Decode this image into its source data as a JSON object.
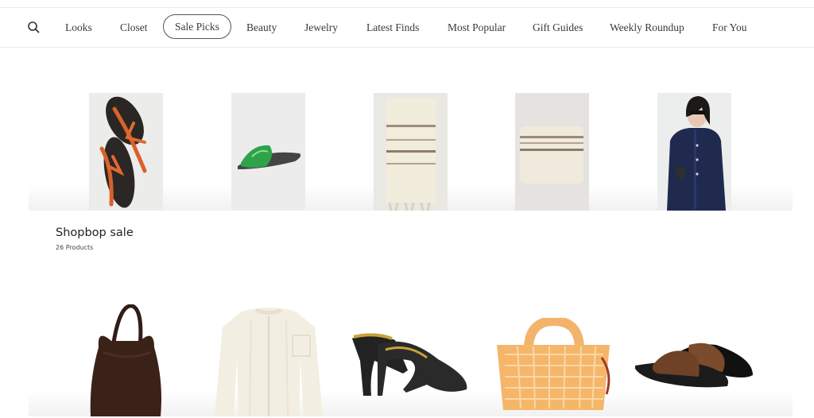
{
  "nav": {
    "search_icon": "search-icon",
    "items": [
      {
        "label": "Looks",
        "active": false
      },
      {
        "label": "Closet",
        "active": false
      },
      {
        "label": "Sale Picks",
        "active": true
      },
      {
        "label": "Beauty",
        "active": false
      },
      {
        "label": "Jewelry",
        "active": false
      },
      {
        "label": "Latest Finds",
        "active": false
      },
      {
        "label": "Most Popular",
        "active": false
      },
      {
        "label": "Gift Guides",
        "active": false
      },
      {
        "label": "Weekly Roundup",
        "active": false
      },
      {
        "label": "For You",
        "active": false
      }
    ]
  },
  "collection": {
    "title": "Shopbop sale",
    "count": "26 Products",
    "top_products": [
      "orange-thong-sandals",
      "green-slide-sandal",
      "striped-knit-scarf",
      "striped-cushion",
      "denim-jacket-look"
    ],
    "bottom_products": [
      "brown-suede-hobo-bag",
      "cream-striped-blouse",
      "black-leather-mules",
      "orange-jelly-tote",
      "brown-leather-slides"
    ]
  },
  "colors": {
    "active_border": "#555555",
    "text": "#3a3a3a",
    "divider": "#ececec"
  }
}
